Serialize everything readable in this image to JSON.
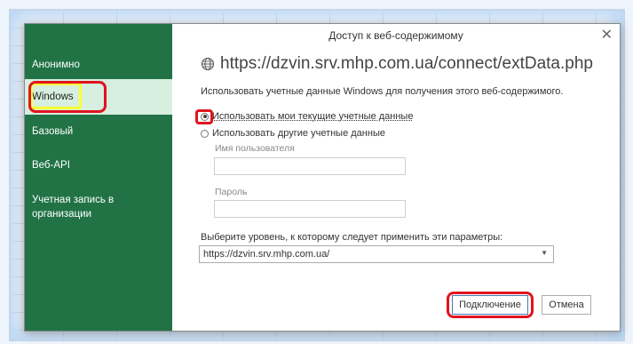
{
  "dialog": {
    "title": "Доступ к веб-содержимому",
    "url": "https://dzvin.srv.mhp.com.ua/connect/extData.php",
    "description": "Использовать учетные данные Windows для получения этого веб-содержимого."
  },
  "sidebar": {
    "items": [
      {
        "label": "Анонимно"
      },
      {
        "label": "Windows"
      },
      {
        "label": "Базовый"
      },
      {
        "label": "Веб-API"
      },
      {
        "label": "Учетная запись в организации"
      }
    ]
  },
  "credentials": {
    "current_label": "Использовать мои текущие учетные данные",
    "other_label": "Использовать другие учетные данные",
    "username_label": "Имя пользователя",
    "username_value": "",
    "password_label": "Пароль",
    "password_value": ""
  },
  "level": {
    "label": "Выберите уровень, к которому следует применить эти параметры:",
    "selected": "https://dzvin.srv.mhp.com.ua/"
  },
  "buttons": {
    "connect": "Подключение",
    "cancel": "Отмена"
  },
  "colors": {
    "sidebar": "#217346",
    "sidebar_selected": "#d6efdf",
    "highlight_red": "#e0141e",
    "highlight_yellow": "#ffff33"
  }
}
